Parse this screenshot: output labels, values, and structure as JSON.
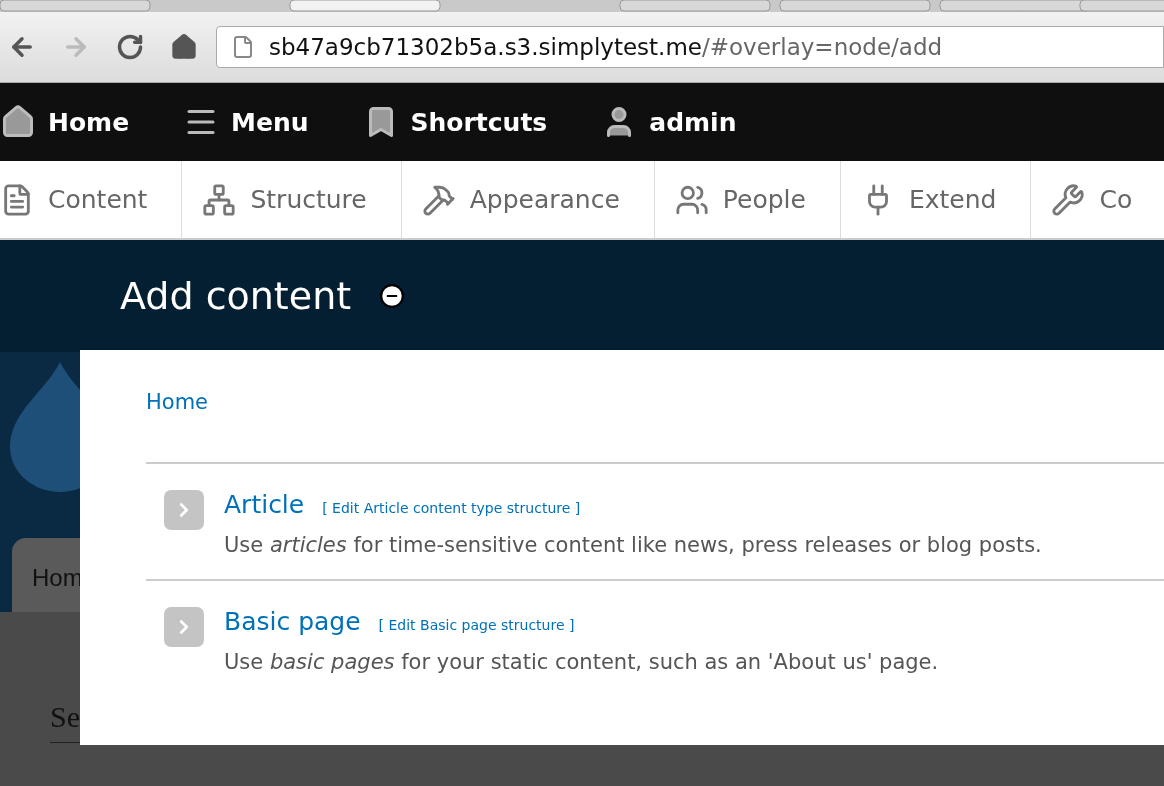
{
  "browser": {
    "url_host": "sb47a9cb71302b5a.s3.simplytest.me",
    "url_path": "/#overlay=node/add"
  },
  "toolbar": [
    {
      "label": "Home",
      "kind": "home"
    },
    {
      "label": "Menu",
      "kind": "menu"
    },
    {
      "label": "Shortcuts",
      "kind": "shortcuts"
    },
    {
      "label": "admin",
      "kind": "user"
    }
  ],
  "admin_menu": [
    {
      "label": "Content",
      "kind": "content"
    },
    {
      "label": "Structure",
      "kind": "structure"
    },
    {
      "label": "Appearance",
      "kind": "appearance"
    },
    {
      "label": "People",
      "kind": "people"
    },
    {
      "label": "Extend",
      "kind": "extend"
    },
    {
      "label": "Co",
      "kind": "config"
    }
  ],
  "overlay_title": "Add content",
  "background": {
    "tab": "Hom",
    "heading": "Se"
  },
  "breadcrumb": "Home",
  "content_types": [
    {
      "name": "Article",
      "edit_link": "[ Edit Article content type structure ]",
      "description": "Use *articles* for time-sensitive content like news, press releases or blog posts."
    },
    {
      "name": "Basic page",
      "edit_link": "[ Edit Basic page structure ]",
      "description": "Use *basic pages* for your static content, such as an 'About us' page."
    }
  ]
}
